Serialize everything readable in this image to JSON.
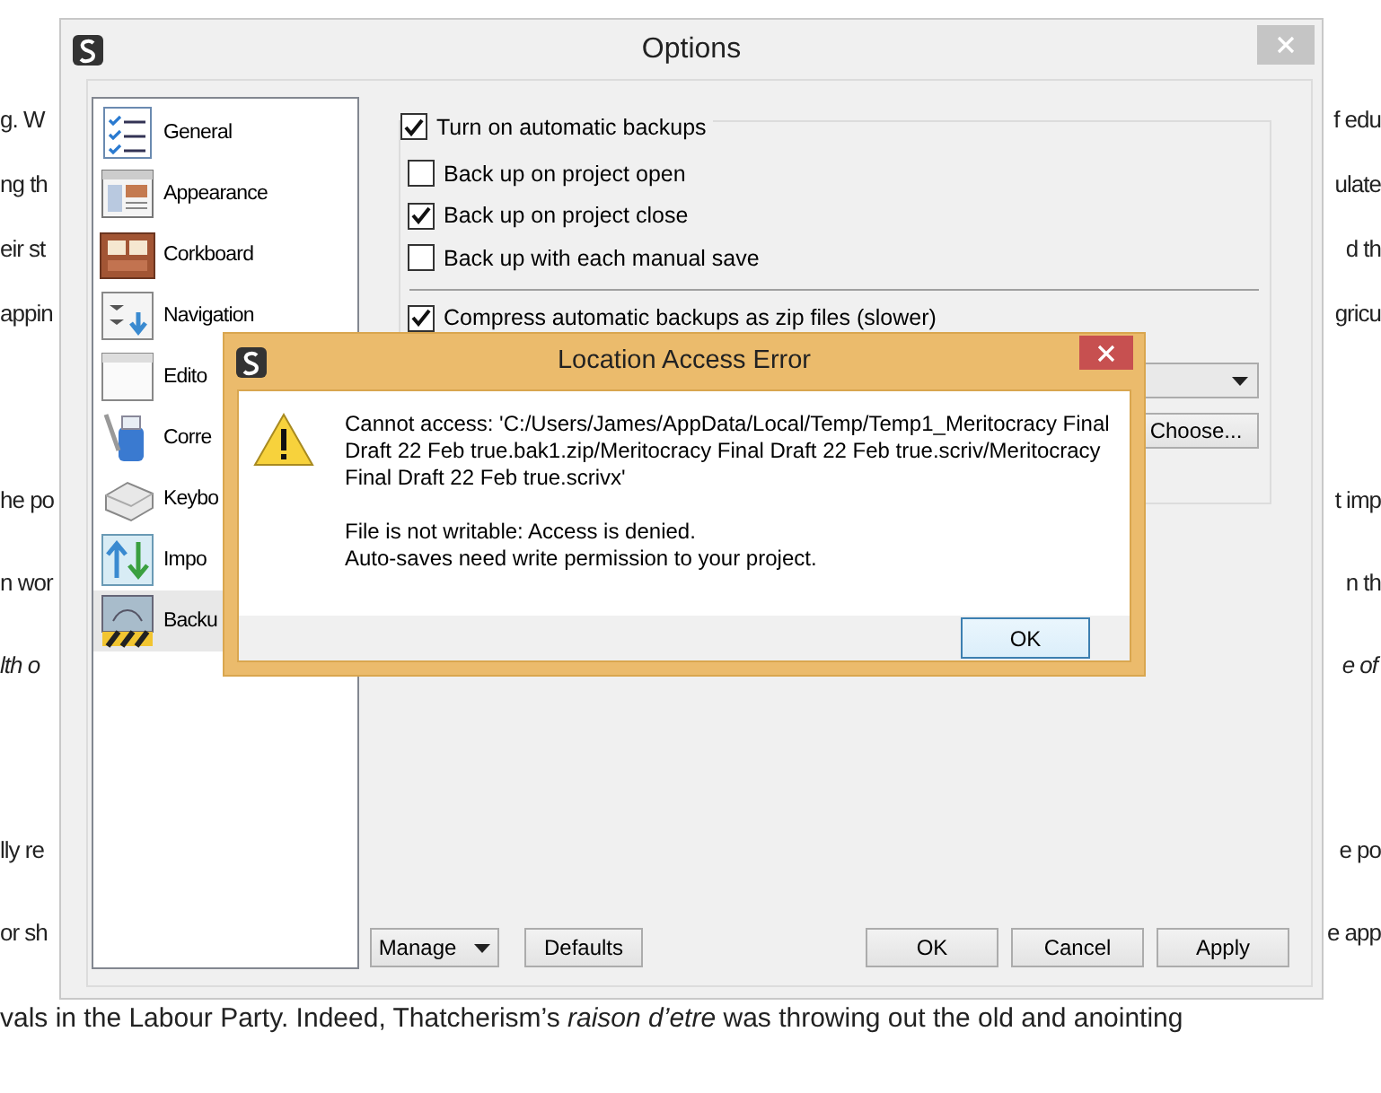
{
  "document": {
    "lines": [
      {
        "left": "g. W",
        "right": "f edu"
      },
      {
        "left": "ng th",
        "right": "ulate"
      },
      {
        "left": "eir st",
        "right": "d th"
      },
      {
        "left": "appin",
        "right": "gricu"
      },
      {
        "left": "he po",
        "right": "t imp"
      },
      {
        "left": "n wor",
        "right": "n th"
      },
      {
        "left": "lth o",
        "right": "e of",
        "italic": true
      },
      {
        "left": "lly re",
        "right": "e po"
      },
      {
        "left": "or sh",
        "right": "e app"
      },
      {
        "left": "vals in the Labour Party. Indeed, Thatcherism’s *raison d’etre* was throwing out the old and anointing"
      }
    ]
  },
  "options_window": {
    "title": "Options",
    "sidebar": {
      "items": [
        {
          "label": "General",
          "kind": "general",
          "selected": false
        },
        {
          "label": "Appearance",
          "kind": "appearance",
          "selected": false
        },
        {
          "label": "Corkboard",
          "kind": "corkboard",
          "selected": false
        },
        {
          "label": "Navigation",
          "kind": "navigation",
          "selected": false
        },
        {
          "label": "Edito",
          "kind": "editor",
          "selected": false
        },
        {
          "label": "Corre",
          "kind": "corrections",
          "selected": false
        },
        {
          "label": "Keybo",
          "kind": "keyboard",
          "selected": false
        },
        {
          "label": "Impo",
          "kind": "import",
          "selected": false
        },
        {
          "label": "Backu",
          "kind": "backup",
          "selected": true
        }
      ]
    },
    "backup_group": {
      "header": {
        "label": "Turn on automatic backups",
        "checked": true
      },
      "options": [
        {
          "label": "Back up on project open",
          "checked": false
        },
        {
          "label": "Back up on project close",
          "checked": true
        },
        {
          "label": "Back up with each manual save",
          "checked": false
        }
      ],
      "compress": {
        "label": "Compress automatic backups as zip files (slower)",
        "checked": true
      },
      "choose_button": "Choose..."
    },
    "left_buttons": [
      {
        "label": "Manage",
        "dropdown": true
      },
      {
        "label": "Defaults",
        "dropdown": false
      }
    ],
    "right_buttons": [
      "OK",
      "Cancel",
      "Apply"
    ]
  },
  "error_dialog": {
    "title": "Location Access Error",
    "message": "Cannot access: 'C:/Users/James/AppData/Local/Temp/Temp1_Meritocracy Final Draft 22 Feb true.bak1.zip/Meritocracy Final Draft 22 Feb true.scriv/Meritocracy Final Draft 22 Feb true.scrivx'",
    "details": [
      "File is not writable: Access is denied.",
      "Auto-saves need write permission to your project."
    ],
    "button": "OK"
  }
}
